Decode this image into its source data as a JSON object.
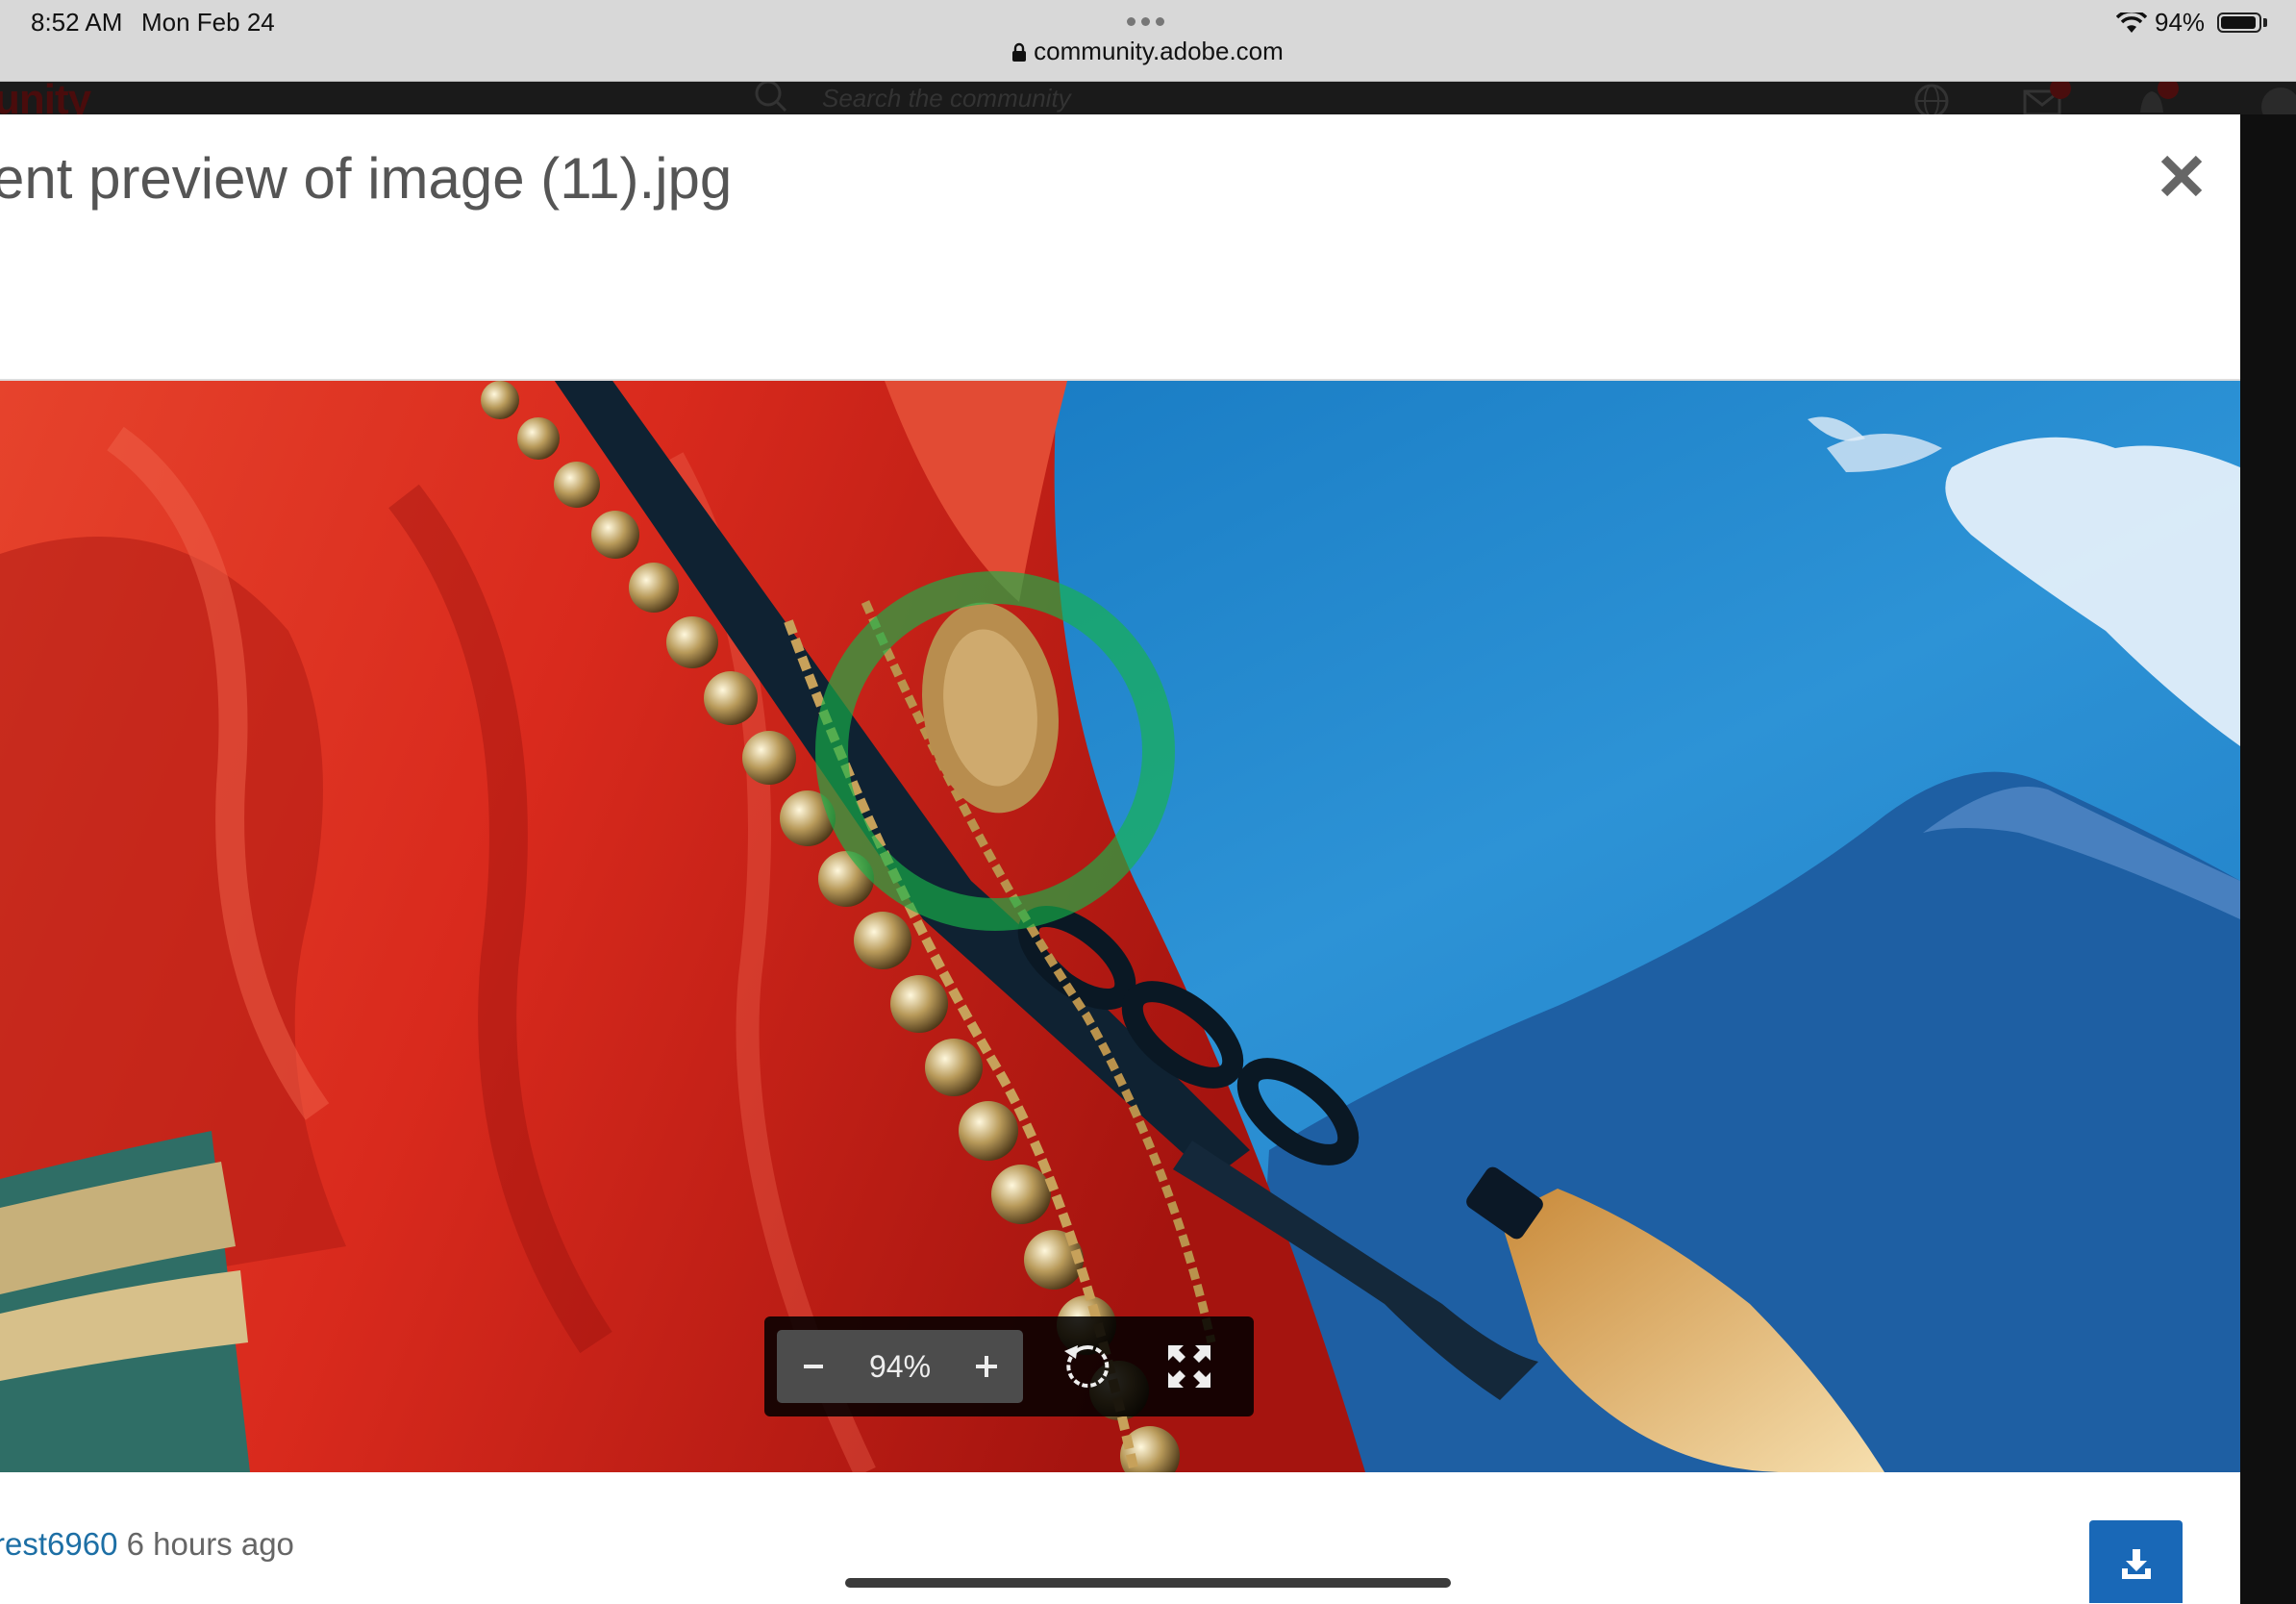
{
  "status_bar": {
    "time": "8:52 AM",
    "date": "Mon Feb 24",
    "battery": "94%",
    "url": "community.adobe.com"
  },
  "background_page": {
    "logo_text": "unity",
    "search_placeholder": "Search the community"
  },
  "modal": {
    "title": "ent preview of image (11).jpg"
  },
  "viewer": {
    "zoom_out_label": "−",
    "zoom_level": "94%",
    "zoom_in_label": "+"
  },
  "footer": {
    "author": "rest6960",
    "time_ago": "6 hours ago"
  },
  "icons": {
    "close": "close-icon",
    "rotate": "rotate-icon",
    "fullscreen": "expand-icon",
    "download": "download-icon"
  },
  "colors": {
    "accent": "#1968b7",
    "link": "#1d6fa5"
  }
}
